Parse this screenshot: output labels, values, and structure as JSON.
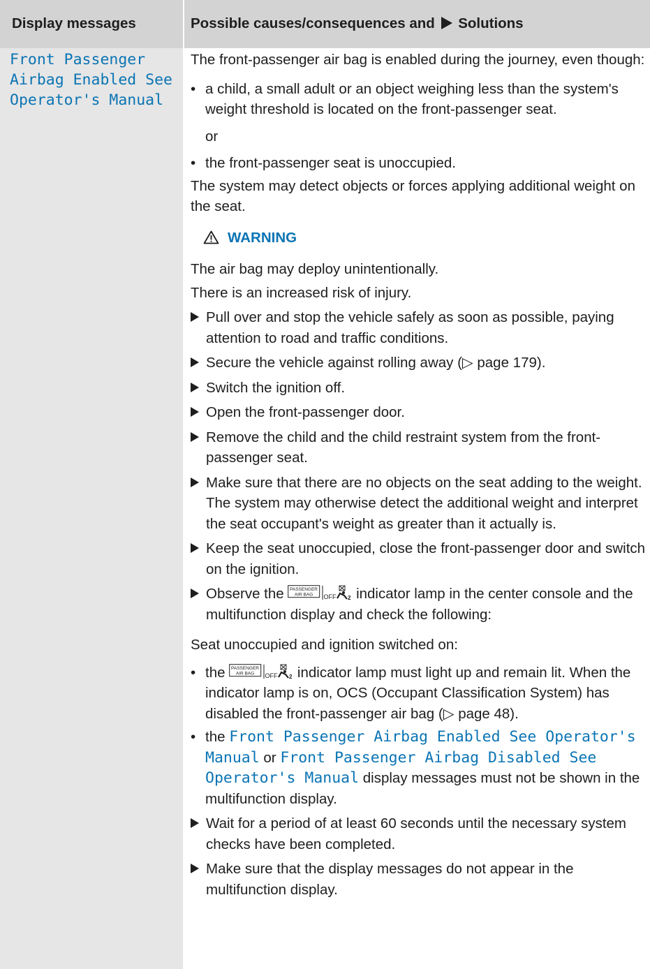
{
  "table": {
    "header": {
      "col1": "Display messages",
      "col2_pre": "Possible causes/consequences and",
      "col2_post": "Solutions",
      "col2_icon": "triangle-right-icon"
    },
    "display_message": "Front Passenger Airbag Enabled See Operator's Manual",
    "intro": "The front-passenger air bag is enabled during the journey, even though:",
    "cause1": "a child, a small adult or an object weighing less than the system's weight threshold is located on the front-passenger seat.",
    "or": "or",
    "cause2": "the front-passenger seat is unoccupied.",
    "detect_note": "The system may detect objects or forces applying additional weight on the seat.",
    "warning": {
      "icon": "warning-triangle-icon",
      "title": "WARNING",
      "line1": "The air bag may deploy unintentionally.",
      "line2": "There is an increased risk of injury."
    },
    "steps": {
      "s1": "Pull over and stop the vehicle safely as soon as possible, paying attention to road and traffic conditions.",
      "s2": "Secure the vehicle against rolling away (▷ page 179).",
      "s3": "Switch the ignition off.",
      "s4": "Open the front-passenger door.",
      "s5": "Remove the child and the child restraint system from the front-passenger seat.",
      "s6": "Make sure that there are no objects on the seat adding to the weight.",
      "s6_note": "The system may otherwise detect the additional weight and interpret the seat occupant's weight as greater than it actually is.",
      "s7": "Keep the seat unoccupied, close the front-passenger door and switch on the ignition.",
      "s8_pre": "Observe the",
      "s8_post": "indicator lamp in the center console and the multifunction display and check the following:",
      "s9": "Wait for a period of at least 60 seconds until the necessary system checks have been completed.",
      "s10": "Make sure that the display messages do not appear in the multifunction display."
    },
    "lamp": {
      "line1": "PASSENGER",
      "line2": "AIR BAG",
      "off": "OFF",
      "icon": "seat-occupant-icon"
    },
    "seat_unoccupied": "Seat unoccupied and ignition switched on:",
    "check1_pre": "the",
    "check1_post": "indicator lamp must light up and remain lit. When the indicator lamp is on, OCS (Occupant Classification System) has disabled the front-passenger air bag (▷ page 48).",
    "check2_the": "the",
    "check2_msg1": "Front Passenger Airbag Enabled See Operator's Manual",
    "check2_or": "or",
    "check2_msg2": "Front Passenger Airbag Disabled See Operator's Manual",
    "check2_post": "display messages must not be shown in the multifunction display."
  }
}
